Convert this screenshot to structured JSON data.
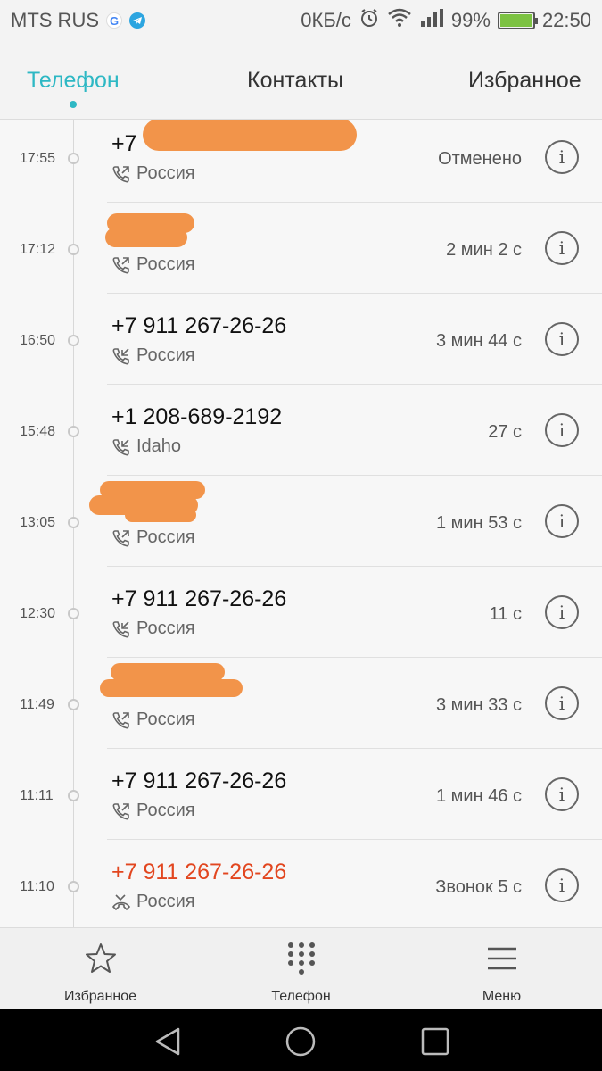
{
  "status_bar": {
    "carrier": "MTS RUS",
    "network_speed": "0КБ/с",
    "battery": "99%",
    "battery_level": 0.99,
    "time": "22:50",
    "icons": [
      "google-icon",
      "telegram-icon",
      "alarm-icon",
      "wifi-icon",
      "signal-icon",
      "battery-icon"
    ]
  },
  "tabs": [
    {
      "label": "Телефон",
      "active": true
    },
    {
      "label": "Контакты",
      "active": false
    },
    {
      "label": "Избранное",
      "active": false
    }
  ],
  "calls": [
    {
      "time": "17:55",
      "number": "+7",
      "redacted": true,
      "location": "Россия",
      "type": "outgoing",
      "duration": "Отменено"
    },
    {
      "time": "17:12",
      "number": "",
      "redacted": true,
      "location": "Россия",
      "type": "outgoing",
      "duration": "2 мин 2 с"
    },
    {
      "time": "16:50",
      "number": "+7 911 267-26-26",
      "redacted": false,
      "location": "Россия",
      "type": "incoming",
      "duration": "3 мин 44 с"
    },
    {
      "time": "15:48",
      "number": "+1 208-689-2192",
      "redacted": false,
      "location": "Idaho",
      "type": "incoming",
      "duration": "27 с"
    },
    {
      "time": "13:05",
      "number": "",
      "redacted": true,
      "location": "Россия",
      "type": "outgoing",
      "duration": "1 мин 53 с"
    },
    {
      "time": "12:30",
      "number": "+7 911 267-26-26",
      "redacted": false,
      "location": "Россия",
      "type": "incoming",
      "duration": "11 с"
    },
    {
      "time": "11:49",
      "number": "",
      "redacted": true,
      "location": "Россия",
      "type": "outgoing",
      "duration": "3 мин 33 с"
    },
    {
      "time": "11:11",
      "number": "+7 911 267-26-26",
      "redacted": false,
      "location": "Россия",
      "type": "outgoing",
      "duration": "1 мин 46 с"
    },
    {
      "time": "11:10",
      "number": "+7 911 267-26-26",
      "redacted": false,
      "location": "Россия",
      "type": "missed",
      "duration": "Звонок 5 с"
    }
  ],
  "info_glyph": "i",
  "bottom_nav": [
    {
      "label": "Избранное",
      "icon": "star-icon"
    },
    {
      "label": "Телефон",
      "icon": "dialpad-icon"
    },
    {
      "label": "Меню",
      "icon": "menu-icon"
    }
  ],
  "system_nav": [
    "back-icon",
    "home-icon",
    "recents-icon"
  ],
  "colors": {
    "accent": "#2eb8c4",
    "missed": "#e2461f",
    "redaction": "#f2944a"
  }
}
